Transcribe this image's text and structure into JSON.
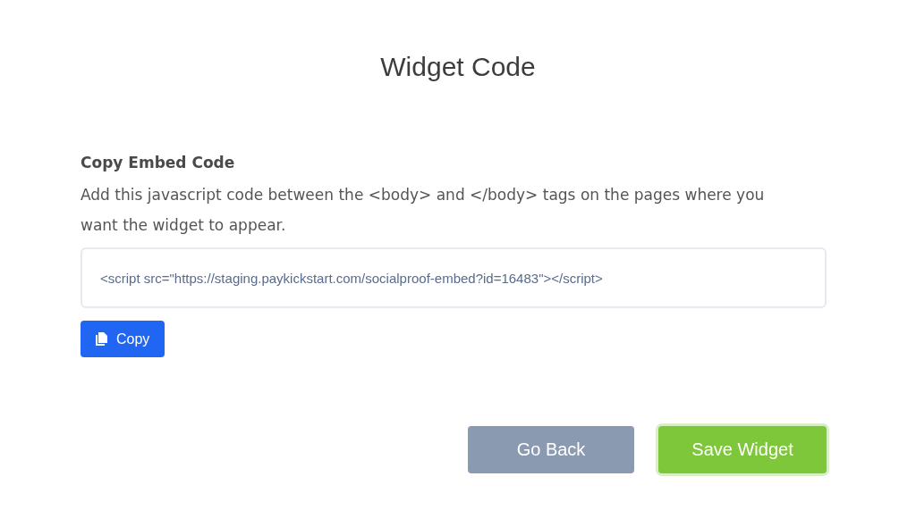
{
  "title": "Widget Code",
  "section": {
    "heading": "Copy Embed Code",
    "description": "Add this javascript code between the <body> and </body> tags on the pages where you want the widget to appear.",
    "code_field": {
      "value": "<script src=\"https://staging.paykickstart.com/socialproof-embed?id=16483\"></script>"
    },
    "copy_button": "Copy"
  },
  "buttons": [
    {
      "label": "Go Back",
      "kind": "secondary"
    },
    {
      "label": "Save Widget",
      "kind": "primary"
    }
  ]
}
